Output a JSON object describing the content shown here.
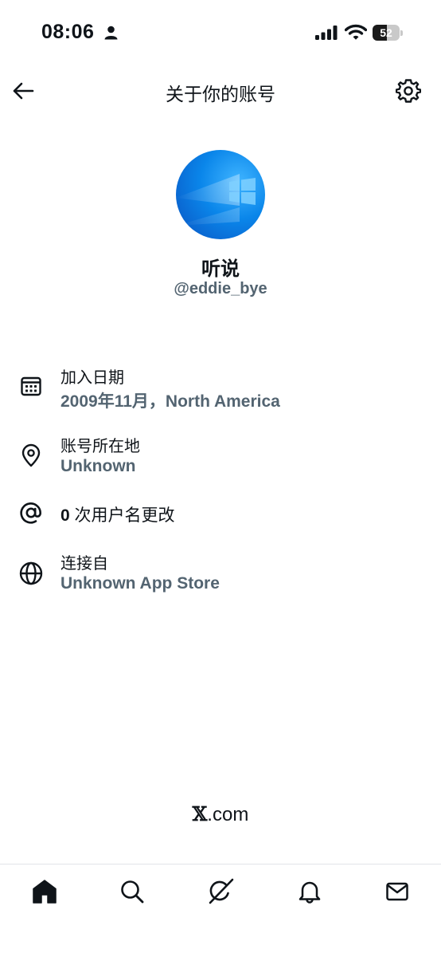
{
  "status_bar": {
    "time": "08:06",
    "battery": "52",
    "battery_level": 0.52
  },
  "header": {
    "title": "关于你的账号"
  },
  "profile": {
    "display_name": "听说",
    "handle": "@eddie_bye"
  },
  "info": {
    "joined_label": "加入日期",
    "joined_value": "2009年11月，North America",
    "location_label": "账号所在地",
    "location_value": "Unknown",
    "username_changes_count": "0",
    "username_changes_label": "次用户名更改",
    "connected_label": "连接自",
    "connected_value": "Unknown App Store"
  },
  "footer": {
    "brand_x": "𝕏",
    "brand_rest": ".com"
  },
  "icons": [
    "back-arrow-icon",
    "gear-icon",
    "calendar-icon",
    "location-pin-icon",
    "at-sign-icon",
    "globe-icon",
    "home-icon",
    "search-icon",
    "grok-icon",
    "bell-icon",
    "mail-icon"
  ],
  "colors": {
    "text_primary": "#0f1419",
    "text_secondary": "#536471",
    "avatar_blue": "#0a78e0"
  }
}
